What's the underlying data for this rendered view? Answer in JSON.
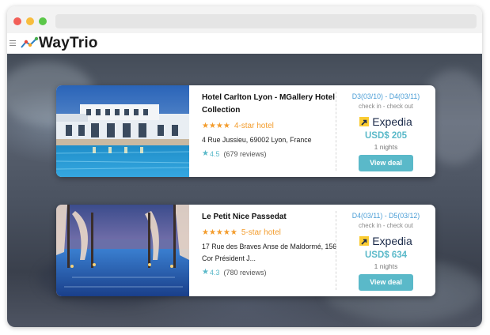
{
  "app": {
    "logo_text": "WayTrio"
  },
  "hotels": [
    {
      "name": "Hotel Carlton Lyon - MGallery Hotel Collection",
      "stars": "★★★★",
      "star_label": "4-star hotel",
      "address": "4 Rue Jussieu, 69002 Lyon, France",
      "rating_star": "★",
      "rating": "4.5",
      "reviews": "(679 reviews)",
      "dates": "D3(03/10) - D4(03/11)",
      "checkinout": "check in - check out",
      "provider": "Expedia",
      "price": "USD$ 205",
      "nights": "1 nights",
      "button": "View deal"
    },
    {
      "name": "Le Petit Nice Passedat",
      "stars": "★★★★★",
      "star_label": "5-star hotel",
      "address": "17 Rue des Braves Anse de Maldormé, 156 Cor Président J...",
      "rating_star": "★",
      "rating": "4.3",
      "reviews": "(780 reviews)",
      "dates": "D4(03/11) - D5(03/12)",
      "checkinout": "check in - check out",
      "provider": "Expedia",
      "price": "USD$ 634",
      "nights": "1 nights",
      "button": "View deal"
    }
  ],
  "colors": {
    "accent": "#5ab9c9",
    "star": "#f39c2c",
    "date": "#4b9ed6",
    "expedia_yellow": "#fbcc33",
    "expedia_navy": "#1c2b4a"
  },
  "icons": {
    "menu": "hamburger-icon",
    "logo": "waytrio-logo-icon",
    "provider": "expedia-arrow-icon"
  }
}
